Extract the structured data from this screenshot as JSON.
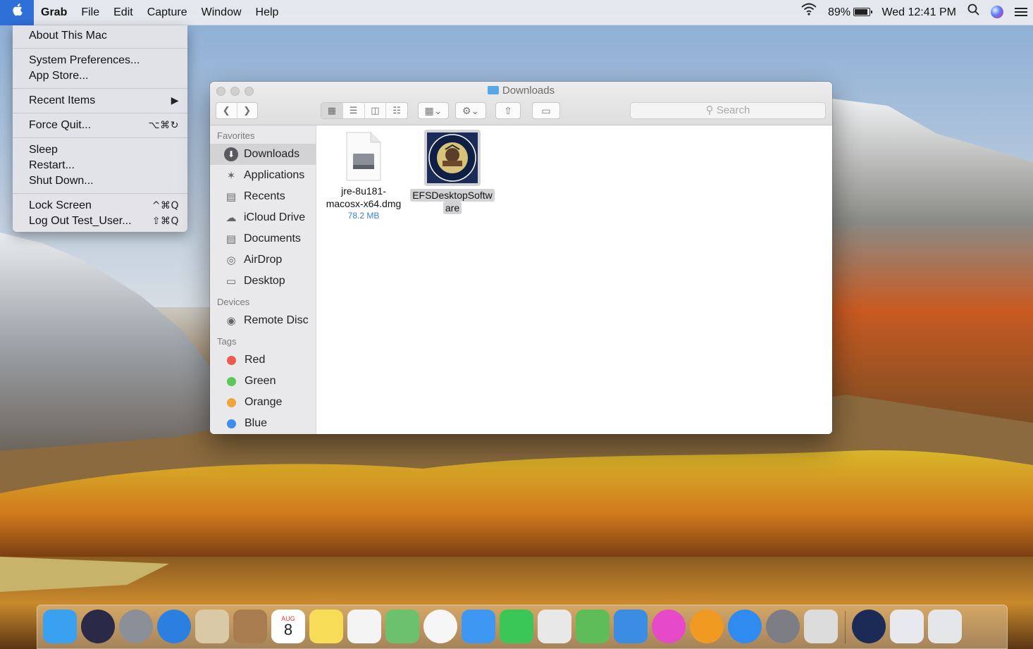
{
  "menubar": {
    "app_name": "Grab",
    "menus": [
      "File",
      "Edit",
      "Capture",
      "Window",
      "Help"
    ],
    "battery_percent": "89%",
    "battery_level": 0.89,
    "clock": "Wed 12:41 PM"
  },
  "apple_menu": {
    "groups": [
      [
        {
          "label": "About This Mac",
          "shortcut": ""
        }
      ],
      [
        {
          "label": "System Preferences...",
          "shortcut": ""
        },
        {
          "label": "App Store...",
          "shortcut": ""
        }
      ],
      [
        {
          "label": "Recent Items",
          "shortcut": "▶"
        }
      ],
      [
        {
          "label": "Force Quit...",
          "shortcut": "⌥⌘↻"
        }
      ],
      [
        {
          "label": "Sleep",
          "shortcut": ""
        },
        {
          "label": "Restart...",
          "shortcut": ""
        },
        {
          "label": "Shut Down...",
          "shortcut": ""
        }
      ],
      [
        {
          "label": "Lock Screen",
          "shortcut": "^⌘Q"
        },
        {
          "label": "Log Out Test_User...",
          "shortcut": "⇧⌘Q"
        }
      ]
    ]
  },
  "finder": {
    "title": "Downloads",
    "search_placeholder": "Search",
    "sidebar": {
      "favorites_header": "Favorites",
      "favorites": [
        {
          "label": "Downloads",
          "icon": "downloads-icon",
          "selected": true
        },
        {
          "label": "Applications",
          "icon": "applications-icon"
        },
        {
          "label": "Recents",
          "icon": "recents-icon"
        },
        {
          "label": "iCloud Drive",
          "icon": "icloud-icon"
        },
        {
          "label": "Documents",
          "icon": "documents-icon"
        },
        {
          "label": "AirDrop",
          "icon": "airdrop-icon"
        },
        {
          "label": "Desktop",
          "icon": "desktop-icon"
        }
      ],
      "devices_header": "Devices",
      "devices": [
        {
          "label": "Remote Disc",
          "icon": "disc-icon"
        }
      ],
      "tags_header": "Tags",
      "tags": [
        {
          "label": "Red",
          "color": "#ee5a50"
        },
        {
          "label": "Green",
          "color": "#5cc85a"
        },
        {
          "label": "Orange",
          "color": "#f3a33b"
        },
        {
          "label": "Blue",
          "color": "#3d8ef0"
        }
      ]
    },
    "files": [
      {
        "name_line1": "jre-8u181-",
        "name_line2": "macosx-x64.dmg",
        "size": "78.2 MB",
        "icon": "dmg-file-icon"
      },
      {
        "name_line1": "EFSDesktopSoftw",
        "name_line2": "are",
        "size": "",
        "icon": "nys-board-of-elections-seal-icon"
      }
    ]
  },
  "dock": {
    "apps": [
      {
        "name": "finder-icon",
        "color": "#3aa0f0"
      },
      {
        "name": "siri-icon",
        "color": "#2a2a48"
      },
      {
        "name": "launchpad-icon",
        "color": "#8a8f98"
      },
      {
        "name": "safari-icon",
        "color": "#2b7fe0"
      },
      {
        "name": "mail-icon",
        "color": "#d9c9a6"
      },
      {
        "name": "contacts-icon",
        "color": "#a87c4e"
      },
      {
        "name": "calendar-icon",
        "color": "#ffffff"
      },
      {
        "name": "notes-icon",
        "color": "#f6dc57"
      },
      {
        "name": "reminders-icon",
        "color": "#f4f4f4"
      },
      {
        "name": "maps-icon",
        "color": "#6cc26c"
      },
      {
        "name": "photos-icon",
        "color": "#f6f6f6"
      },
      {
        "name": "messages-icon",
        "color": "#3d97f3"
      },
      {
        "name": "facetime-icon",
        "color": "#3bc758"
      },
      {
        "name": "textedit-icon",
        "color": "#e8e8e8"
      },
      {
        "name": "numbers-icon",
        "color": "#5fbd59"
      },
      {
        "name": "keynote-icon",
        "color": "#3a8de2"
      },
      {
        "name": "itunes-icon",
        "color": "#e74ac8"
      },
      {
        "name": "ibooks-icon",
        "color": "#f19a22"
      },
      {
        "name": "app-store-icon",
        "color": "#2f8bf0"
      },
      {
        "name": "system-preferences-icon",
        "color": "#7d7d85"
      },
      {
        "name": "grab-icon",
        "color": "#dcdcdc"
      },
      {
        "name": "efs-app-icon",
        "color": "#1b2b55"
      },
      {
        "name": "downloads-stack-icon",
        "color": "#e7e9ef"
      },
      {
        "name": "trash-icon",
        "color": "#e4e6ea"
      }
    ],
    "calendar_month": "AUG",
    "calendar_day": "8"
  }
}
